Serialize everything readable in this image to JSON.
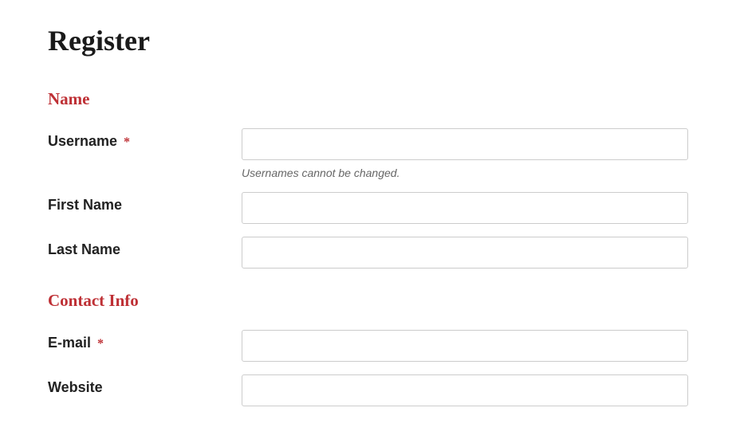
{
  "title": "Register",
  "sections": {
    "name": {
      "heading": "Name",
      "fields": {
        "username": {
          "label": "Username",
          "required_mark": "*",
          "value": "",
          "helper": "Usernames cannot be changed."
        },
        "first_name": {
          "label": "First Name",
          "value": ""
        },
        "last_name": {
          "label": "Last Name",
          "value": ""
        }
      }
    },
    "contact": {
      "heading": "Contact Info",
      "fields": {
        "email": {
          "label": "E-mail",
          "required_mark": "*",
          "value": ""
        },
        "website": {
          "label": "Website",
          "value": ""
        }
      }
    }
  }
}
